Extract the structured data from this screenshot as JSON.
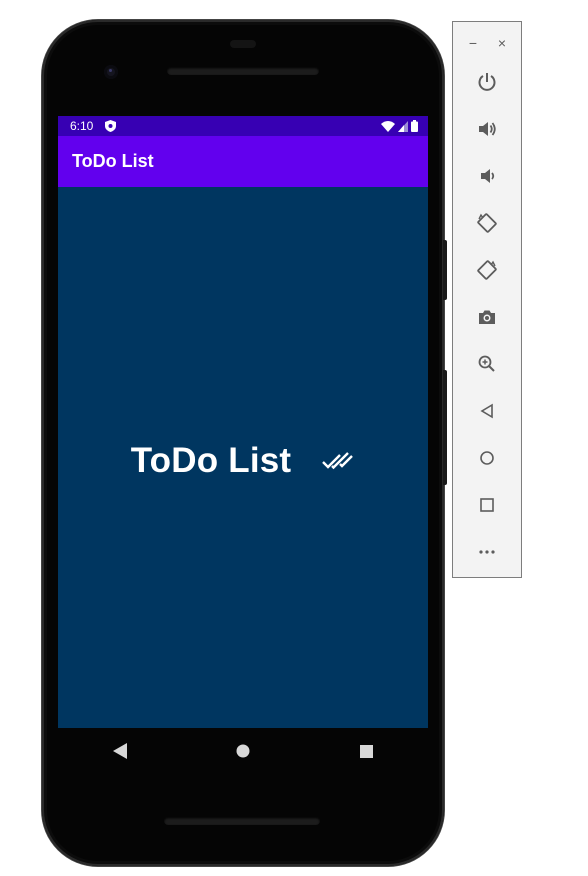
{
  "status_bar": {
    "time": "6:10"
  },
  "app_bar": {
    "title": "ToDo List"
  },
  "splash": {
    "title": "ToDo List",
    "icon": "double-check-icon"
  },
  "nav_bar": {
    "buttons": [
      "back-icon",
      "home-icon",
      "recents-icon"
    ]
  },
  "toolbar": {
    "minimize": "−",
    "close": "×",
    "buttons": [
      "power",
      "volume-up",
      "volume-down",
      "rotate-left",
      "rotate-right",
      "screenshot",
      "zoom",
      "back",
      "home",
      "overview",
      "more"
    ]
  },
  "colors": {
    "status_bar": "#3700b3",
    "app_bar": "#6200ee",
    "background": "#003660",
    "text": "#ffffff"
  }
}
